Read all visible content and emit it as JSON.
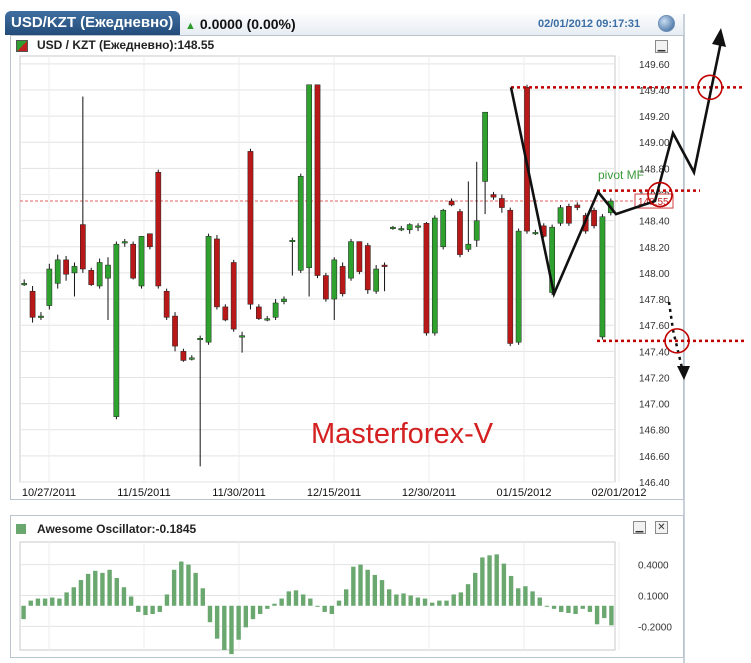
{
  "header": {
    "tab_label": "USD/KZT (Ежедневно)",
    "change": "0.0000 (0.00%)",
    "datetime": "02/01/2012 09:17:31"
  },
  "price_panel": {
    "title": "USD / KZT (Ежедневно):148.55",
    "last_price_label": "148.55",
    "watermark": "Masterforex-V",
    "pivot_label": "pivot MF"
  },
  "oscillator_panel": {
    "title": "Awesome Oscillator:-0.1845"
  },
  "colors": {
    "up": "#2fa12f",
    "down": "#b81818",
    "oscillator": "#6aa870",
    "annotation": "#c00000"
  },
  "chart_data": [
    {
      "type": "candlestick",
      "title": "USD / KZT (Ежедневно):148.55",
      "x_tick_labels": [
        "10/27/2011",
        "11/15/2011",
        "11/30/2011",
        "12/15/2011",
        "12/30/2011",
        "01/15/2012",
        "02/01/2012"
      ],
      "y_ticks": [
        146.4,
        146.6,
        146.8,
        147.0,
        147.2,
        147.4,
        147.6,
        147.8,
        148.0,
        148.2,
        148.4,
        148.6,
        148.8,
        149.0,
        149.2,
        149.4,
        149.6
      ],
      "y_tick_labels": [
        "146.40",
        "146.60",
        "146.80",
        "147.00",
        "147.20",
        "147.40",
        "147.60",
        "147.80",
        "148.00",
        "148.20",
        "148.40",
        "148.60",
        "148.80",
        "149.00",
        "149.20",
        "149.40",
        "149.60"
      ],
      "ylim": [
        146.4,
        149.66
      ],
      "grid": true,
      "last_price": 148.55,
      "candles": [
        {
          "o": 147.92,
          "h": 147.95,
          "l": 147.9,
          "c": 147.92
        },
        {
          "o": 147.86,
          "h": 147.9,
          "l": 147.62,
          "c": 147.66
        },
        {
          "o": 147.67,
          "h": 147.7,
          "l": 147.64,
          "c": 147.67
        },
        {
          "o": 147.75,
          "h": 148.07,
          "l": 147.72,
          "c": 148.03
        },
        {
          "o": 147.92,
          "h": 148.14,
          "l": 147.88,
          "c": 148.1
        },
        {
          "o": 148.1,
          "h": 148.13,
          "l": 147.94,
          "c": 147.99
        },
        {
          "o": 148.0,
          "h": 148.08,
          "l": 147.82,
          "c": 148.05
        },
        {
          "o": 148.37,
          "h": 149.35,
          "l": 148.0,
          "c": 148.03
        },
        {
          "o": 148.02,
          "h": 148.04,
          "l": 147.9,
          "c": 147.91
        },
        {
          "o": 147.9,
          "h": 148.11,
          "l": 147.88,
          "c": 148.08
        },
        {
          "o": 147.96,
          "h": 148.12,
          "l": 147.64,
          "c": 148.06
        },
        {
          "o": 146.9,
          "h": 148.24,
          "l": 146.88,
          "c": 148.22
        },
        {
          "o": 148.24,
          "h": 148.26,
          "l": 148.2,
          "c": 148.24
        },
        {
          "o": 148.22,
          "h": 148.24,
          "l": 147.95,
          "c": 147.96
        },
        {
          "o": 147.9,
          "h": 148.28,
          "l": 147.88,
          "c": 148.28
        },
        {
          "o": 148.3,
          "h": 148.3,
          "l": 148.18,
          "c": 148.2
        },
        {
          "o": 148.77,
          "h": 148.79,
          "l": 147.88,
          "c": 147.9
        },
        {
          "o": 147.86,
          "h": 147.88,
          "l": 147.64,
          "c": 147.66
        },
        {
          "o": 147.67,
          "h": 147.7,
          "l": 147.4,
          "c": 147.44
        },
        {
          "o": 147.4,
          "h": 147.42,
          "l": 147.32,
          "c": 147.33
        },
        {
          "o": 147.35,
          "h": 147.37,
          "l": 147.33,
          "c": 147.35
        },
        {
          "o": 147.5,
          "h": 147.52,
          "l": 146.52,
          "c": 147.5
        },
        {
          "o": 147.47,
          "h": 148.3,
          "l": 147.45,
          "c": 148.28
        },
        {
          "o": 148.26,
          "h": 148.29,
          "l": 147.72,
          "c": 147.74
        },
        {
          "o": 147.74,
          "h": 147.76,
          "l": 147.63,
          "c": 147.64
        },
        {
          "o": 148.08,
          "h": 148.1,
          "l": 147.55,
          "c": 147.57
        },
        {
          "o": 147.51,
          "h": 147.55,
          "l": 147.39,
          "c": 147.52
        },
        {
          "o": 148.93,
          "h": 148.95,
          "l": 147.72,
          "c": 147.76
        },
        {
          "o": 147.74,
          "h": 147.76,
          "l": 147.64,
          "c": 147.65
        },
        {
          "o": 147.65,
          "h": 147.67,
          "l": 147.63,
          "c": 147.65
        },
        {
          "o": 147.66,
          "h": 147.8,
          "l": 147.64,
          "c": 147.77
        },
        {
          "o": 147.78,
          "h": 147.82,
          "l": 147.76,
          "c": 147.8
        },
        {
          "o": 148.25,
          "h": 148.27,
          "l": 147.98,
          "c": 148.25
        },
        {
          "o": 148.02,
          "h": 148.76,
          "l": 148.0,
          "c": 148.74
        },
        {
          "o": 148.04,
          "h": 149.44,
          "l": 147.82,
          "c": 149.44
        },
        {
          "o": 149.44,
          "h": 149.44,
          "l": 147.96,
          "c": 147.98
        },
        {
          "o": 147.98,
          "h": 148.0,
          "l": 147.78,
          "c": 147.8
        },
        {
          "o": 147.8,
          "h": 148.12,
          "l": 147.64,
          "c": 148.1
        },
        {
          "o": 148.05,
          "h": 148.08,
          "l": 147.82,
          "c": 147.84
        },
        {
          "o": 147.96,
          "h": 148.26,
          "l": 147.94,
          "c": 148.24
        },
        {
          "o": 148.24,
          "h": 148.24,
          "l": 147.99,
          "c": 148.01
        },
        {
          "o": 148.21,
          "h": 148.23,
          "l": 147.84,
          "c": 147.87
        },
        {
          "o": 147.86,
          "h": 148.06,
          "l": 147.84,
          "c": 148.03
        },
        {
          "o": 148.06,
          "h": 148.08,
          "l": 147.86,
          "c": 148.05
        },
        {
          "o": 148.35,
          "h": 148.36,
          "l": 148.33,
          "c": 148.35
        },
        {
          "o": 148.34,
          "h": 148.36,
          "l": 148.32,
          "c": 148.34
        },
        {
          "o": 148.33,
          "h": 148.38,
          "l": 148.3,
          "c": 148.37
        },
        {
          "o": 148.36,
          "h": 148.38,
          "l": 148.32,
          "c": 148.36
        },
        {
          "o": 148.38,
          "h": 148.39,
          "l": 147.52,
          "c": 147.54
        },
        {
          "o": 147.54,
          "h": 148.44,
          "l": 147.52,
          "c": 148.42
        },
        {
          "o": 148.2,
          "h": 148.49,
          "l": 148.18,
          "c": 148.48
        },
        {
          "o": 148.55,
          "h": 148.57,
          "l": 148.51,
          "c": 148.52
        },
        {
          "o": 148.47,
          "h": 148.49,
          "l": 148.12,
          "c": 148.14
        },
        {
          "o": 148.18,
          "h": 148.7,
          "l": 148.16,
          "c": 148.22
        },
        {
          "o": 148.25,
          "h": 148.85,
          "l": 148.2,
          "c": 148.4
        },
        {
          "o": 148.7,
          "h": 149.23,
          "l": 148.45,
          "c": 149.23
        },
        {
          "o": 148.6,
          "h": 148.62,
          "l": 148.56,
          "c": 148.58
        },
        {
          "o": 148.57,
          "h": 148.6,
          "l": 148.46,
          "c": 148.5
        },
        {
          "o": 148.48,
          "h": 148.5,
          "l": 147.44,
          "c": 147.46
        },
        {
          "o": 147.47,
          "h": 148.34,
          "l": 147.45,
          "c": 148.32
        },
        {
          "o": 149.42,
          "h": 149.44,
          "l": 148.3,
          "c": 148.32
        },
        {
          "o": 148.31,
          "h": 148.33,
          "l": 148.29,
          "c": 148.31
        },
        {
          "o": 148.36,
          "h": 148.38,
          "l": 148.27,
          "c": 148.28
        },
        {
          "o": 147.85,
          "h": 148.37,
          "l": 147.83,
          "c": 148.35
        },
        {
          "o": 148.38,
          "h": 148.52,
          "l": 148.36,
          "c": 148.5
        },
        {
          "o": 148.51,
          "h": 148.53,
          "l": 148.36,
          "c": 148.38
        },
        {
          "o": 148.52,
          "h": 148.54,
          "l": 148.48,
          "c": 148.5
        },
        {
          "o": 148.44,
          "h": 148.46,
          "l": 148.3,
          "c": 148.32
        },
        {
          "o": 148.48,
          "h": 148.5,
          "l": 148.34,
          "c": 148.36
        },
        {
          "o": 147.51,
          "h": 148.45,
          "l": 147.49,
          "c": 148.43
        },
        {
          "o": 148.46,
          "h": 148.57,
          "l": 148.44,
          "c": 148.55
        }
      ]
    },
    {
      "type": "bar",
      "title": "Awesome Oscillator:-0.1845",
      "y_ticks": [
        -0.2,
        0.1,
        0.4
      ],
      "y_tick_labels": [
        "-0.2000",
        "0.1000",
        "0.4000"
      ],
      "ylim": [
        -0.43,
        0.62
      ],
      "grid": true,
      "values": [
        -0.13,
        0.05,
        0.07,
        0.07,
        0.08,
        0.07,
        0.13,
        0.18,
        0.25,
        0.31,
        0.34,
        0.32,
        0.35,
        0.27,
        0.18,
        0.09,
        -0.06,
        -0.09,
        -0.08,
        -0.06,
        0.11,
        0.35,
        0.43,
        0.4,
        0.32,
        0.17,
        -0.16,
        -0.32,
        -0.43,
        -0.47,
        -0.33,
        -0.21,
        -0.13,
        -0.08,
        -0.03,
        0.02,
        0.07,
        0.14,
        0.15,
        0.11,
        0.07,
        0.0,
        -0.06,
        -0.08,
        0.05,
        0.16,
        0.38,
        0.4,
        0.35,
        0.3,
        0.25,
        0.16,
        0.11,
        0.12,
        0.1,
        0.08,
        0.07,
        0.03,
        0.05,
        0.05,
        0.11,
        0.13,
        0.21,
        0.32,
        0.47,
        0.49,
        0.5,
        0.41,
        0.29,
        0.17,
        0.19,
        0.14,
        0.08,
        0.0,
        -0.03,
        -0.06,
        -0.07,
        -0.08,
        -0.03,
        -0.06,
        -0.18,
        -0.12,
        -0.19
      ]
    }
  ]
}
